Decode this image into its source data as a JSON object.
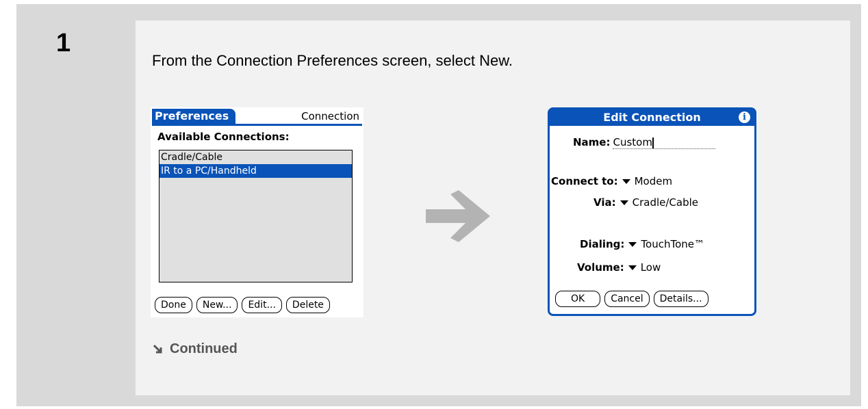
{
  "step": {
    "number": "1"
  },
  "instruction": "From the Connection Preferences screen, select New.",
  "continued": "Continued",
  "screen1": {
    "tab_label": "Preferences",
    "right_label": "Connection",
    "heading": "Available Connections:",
    "items": [
      {
        "label": "Cradle/Cable",
        "selected": false
      },
      {
        "label": "IR to a PC/Handheld",
        "selected": true
      }
    ],
    "buttons": {
      "done": "Done",
      "new": "New...",
      "edit": "Edit...",
      "delete": "Delete"
    }
  },
  "screen2": {
    "title": "Edit Connection",
    "info_icon": "i",
    "name_label": "Name:",
    "name_value": "Custom",
    "connect_label": "Connect to:",
    "connect_value": "Modem",
    "via_label": "Via:",
    "via_value": "Cradle/Cable",
    "dialing_label": "Dialing:",
    "dialing_value": "TouchTone™",
    "volume_label": "Volume:",
    "volume_value": "Low",
    "buttons": {
      "ok": "OK",
      "cancel": "Cancel",
      "details": "Details..."
    }
  },
  "colors": {
    "palm_blue": "#0a53b8",
    "arrow_gray": "#b3b3b3",
    "frame_gray": "#d9d9d9"
  }
}
